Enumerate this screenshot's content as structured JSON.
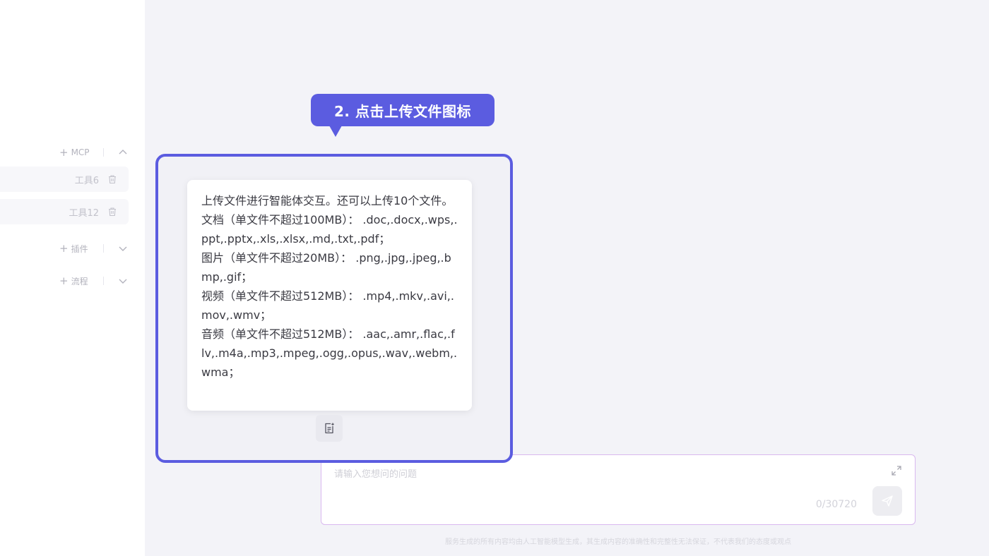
{
  "sidebar": {
    "mcp_label": "MCP",
    "tools": [
      {
        "name": "工具6"
      },
      {
        "name": "工具12"
      }
    ],
    "plugins_label": "插件",
    "flow_label": "流程"
  },
  "callout": {
    "text": "2. 点击上传文件图标",
    "color": "#5b5ce0"
  },
  "tooltip": {
    "lines": [
      "上传文件进行智能体交互。还可以上传10个文件。",
      "文档（单文件不超过100MB）： .doc,.docx,.wps,.ppt,.pptx,.xls,.xlsx,.md,.txt,.pdf；",
      "图片（单文件不超过20MB）： .png,.jpg,.jpeg,.bmp,.gif；",
      "视频（单文件不超过512MB）： .mp4,.mkv,.avi,.mov,.wmv；",
      "音频（单文件不超过512MB）： .aac,.amr,.flac,.flv,.m4a,.mp3,.mpeg,.ogg,.opus,.wav,.webm,.wma；"
    ]
  },
  "upload_icon": "upload-file-icon",
  "input": {
    "placeholder": "请输入您想问的问题",
    "counter": "0/30720"
  },
  "disclaimer": "服务生成的所有内容均由人工智能模型生成，其生成内容的准确性和完整性无法保证，不代表我们的态度或观点"
}
